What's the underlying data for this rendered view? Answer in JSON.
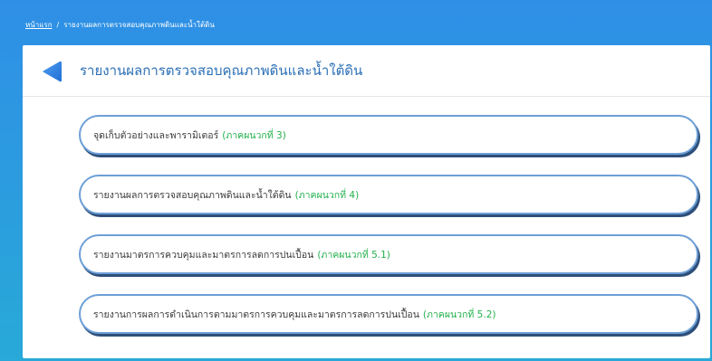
{
  "breadcrumb": {
    "home": "หน้าแรก",
    "separator": "/",
    "current": "รายงานผลการตรวจสอบคุณภาพดินและน้ำใต้ดิน"
  },
  "header": {
    "title": "รายงานผลการตรวจสอบคุณภาพดินและน้ำใต้ดิน"
  },
  "menu": {
    "items": [
      {
        "label": "จุดเก็บตัวอย่างและพารามิเตอร์",
        "appendix": "(ภาคผนวกที่ 3)"
      },
      {
        "label": "รายงานผลการตรวจสอบคุณภาพดินและน้ำใต้ดิน",
        "appendix": "(ภาคผนวกที่ 4)"
      },
      {
        "label": "รายงานมาตรการควบคุมและมาตรการลดการปนเปื้อน",
        "appendix": "(ภาคผนวกที่ 5.1)"
      },
      {
        "label": "รายงานการผลการดำเนินการตามมาตรการควบคุมและมาตรการลดการปนเปื้อน",
        "appendix": "(ภาคผนวกที่ 5.2)"
      }
    ]
  },
  "colors": {
    "background_top": "#2f8fe6",
    "background_bottom": "#28a9d8",
    "title": "#2b6fb5",
    "appendix": "#22b14c",
    "button_border": "#6d9fd6"
  },
  "icons": {
    "back": "back-arrow-icon"
  }
}
